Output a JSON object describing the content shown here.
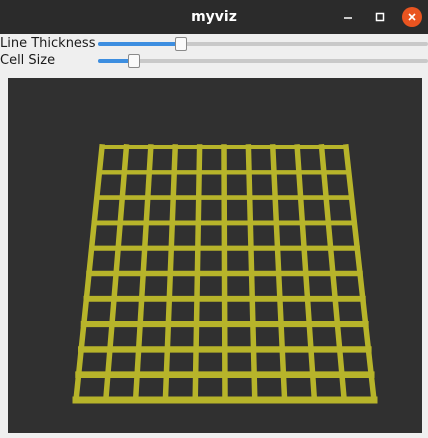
{
  "window": {
    "title": "myviz"
  },
  "controls": {
    "line_thickness": {
      "label": "Line Thickness",
      "value": 0.25
    },
    "cell_size": {
      "label": "Cell Size",
      "value": 0.11
    }
  },
  "viewport": {
    "background_color": "#303030",
    "grid_color": "#b7b42a",
    "grid_cells": 10
  },
  "colors": {
    "titlebar": "#2b2b2b",
    "close_button": "#e95420",
    "slider_fill": "#3d8ee0"
  },
  "icons": {
    "minimize": "minimize-icon",
    "maximize": "maximize-icon",
    "close": "close-icon"
  }
}
